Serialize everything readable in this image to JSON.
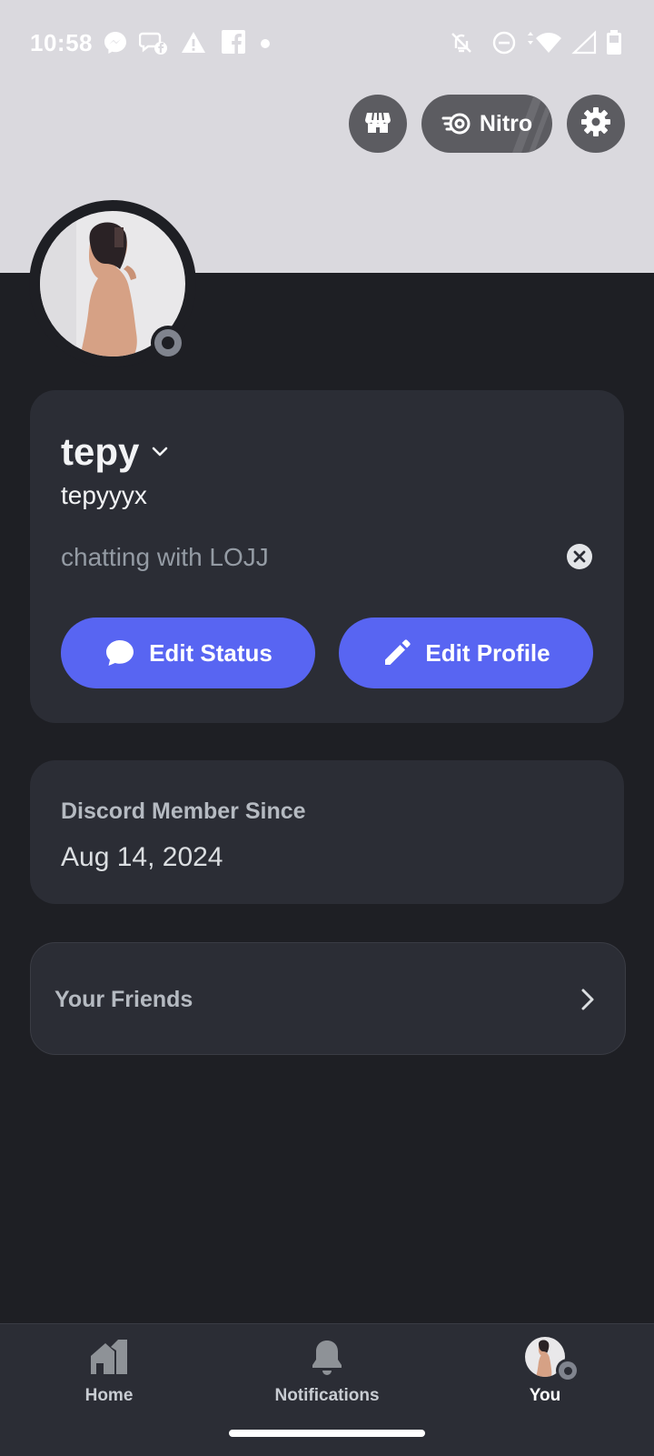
{
  "status_bar": {
    "time": "10:58",
    "icons": [
      "messenger-icon",
      "facebook-chat-icon",
      "warning-icon",
      "facebook-icon",
      "dot-icon",
      "bell-off-icon",
      "do-not-disturb-icon",
      "wifi-icon",
      "signal-icon",
      "battery-icon"
    ]
  },
  "header": {
    "shop_icon": "shop-icon",
    "nitro_label": "Nitro",
    "settings_icon": "gear-icon"
  },
  "profile": {
    "display_name": "tepy",
    "username": "tepyyyx",
    "custom_status": "chatting with LOJJ",
    "presence": "offline",
    "edit_status_label": "Edit Status",
    "edit_profile_label": "Edit Profile"
  },
  "member_since": {
    "label": "Discord Member Since",
    "date": "Aug 14, 2024"
  },
  "friends": {
    "label": "Your Friends"
  },
  "bottom_nav": {
    "items": [
      {
        "label": "Home",
        "icon": "home-icon"
      },
      {
        "label": "Notifications",
        "icon": "bell-icon"
      },
      {
        "label": "You",
        "icon": "avatar"
      }
    ],
    "active": "You"
  },
  "colors": {
    "background": "#1e1f24",
    "card": "#2b2d35",
    "banner": "#dad9de",
    "accent": "#5865f2"
  }
}
